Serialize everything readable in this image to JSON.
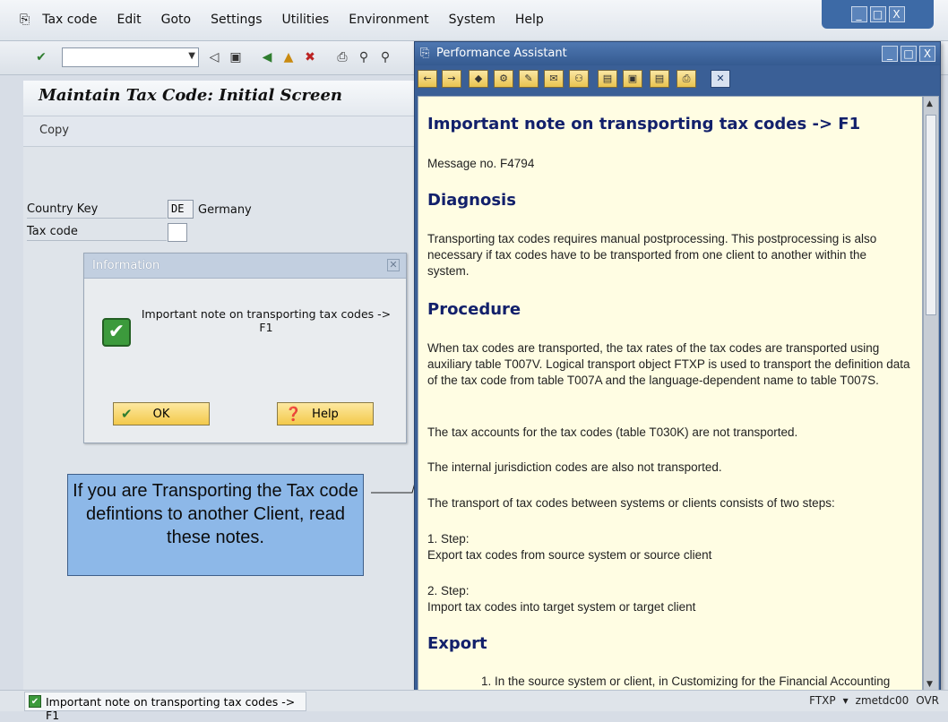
{
  "menu": {
    "items": [
      "Tax code",
      "Edit",
      "Goto",
      "Settings",
      "Utilities",
      "Environment",
      "System",
      "Help"
    ]
  },
  "window_controls": [
    "_",
    "□",
    "X"
  ],
  "toolbar": {
    "command_field_value": ""
  },
  "screen": {
    "title": "Maintain Tax Code: Initial Screen",
    "copy_label": "Copy",
    "country_key_label": "Country Key",
    "country_key_value": "DE",
    "country_name": "Germany",
    "tax_code_label": "Tax code",
    "tax_code_value": ""
  },
  "info_dialog": {
    "title": "Information",
    "message": "Important note on transporting tax codes -> F1",
    "ok_label": "OK",
    "help_label": "Help"
  },
  "callout": {
    "text": "If you are Transporting the Tax code defintions to another Client, read these notes."
  },
  "status_bar": {
    "message": "Important note on transporting tax codes -> F1",
    "transaction": "FTXP",
    "server": "zmetdc00",
    "mode": "OVR"
  },
  "assistant": {
    "title": "Performance Assistant",
    "heading": "Important note on transporting tax codes -> F1",
    "message_no": "Message no. F4794",
    "diagnosis_heading": "Diagnosis",
    "diagnosis_text": "Transporting tax codes requires manual postprocessing. This postprocessing is also necessary if tax codes have to be transported from one client to another within the system.",
    "procedure_heading": "Procedure",
    "procedure_p1": "When tax codes are transported, the tax rates of the tax codes are transported using auxiliary table T007V. Logical transport object FTXP is used to transport the definition data of the tax code from table T007A and the language-dependent name to table T007S.",
    "procedure_p2": "The tax accounts for the tax codes (table T030K) are not transported.",
    "procedure_p3": "The internal jurisdiction codes are also not transported.",
    "procedure_p4": "The transport of tax codes between systems or clients consists of two steps:",
    "step1_title": "1. Step:",
    "step1_text": "Export tax codes from source system or source client",
    "step2_title": "2. Step:",
    "step2_text": "Import tax codes into target system or target client",
    "export_heading": "Export",
    "export_p1": "1. In the source system or client, in Customizing for the Financial Accounting"
  }
}
